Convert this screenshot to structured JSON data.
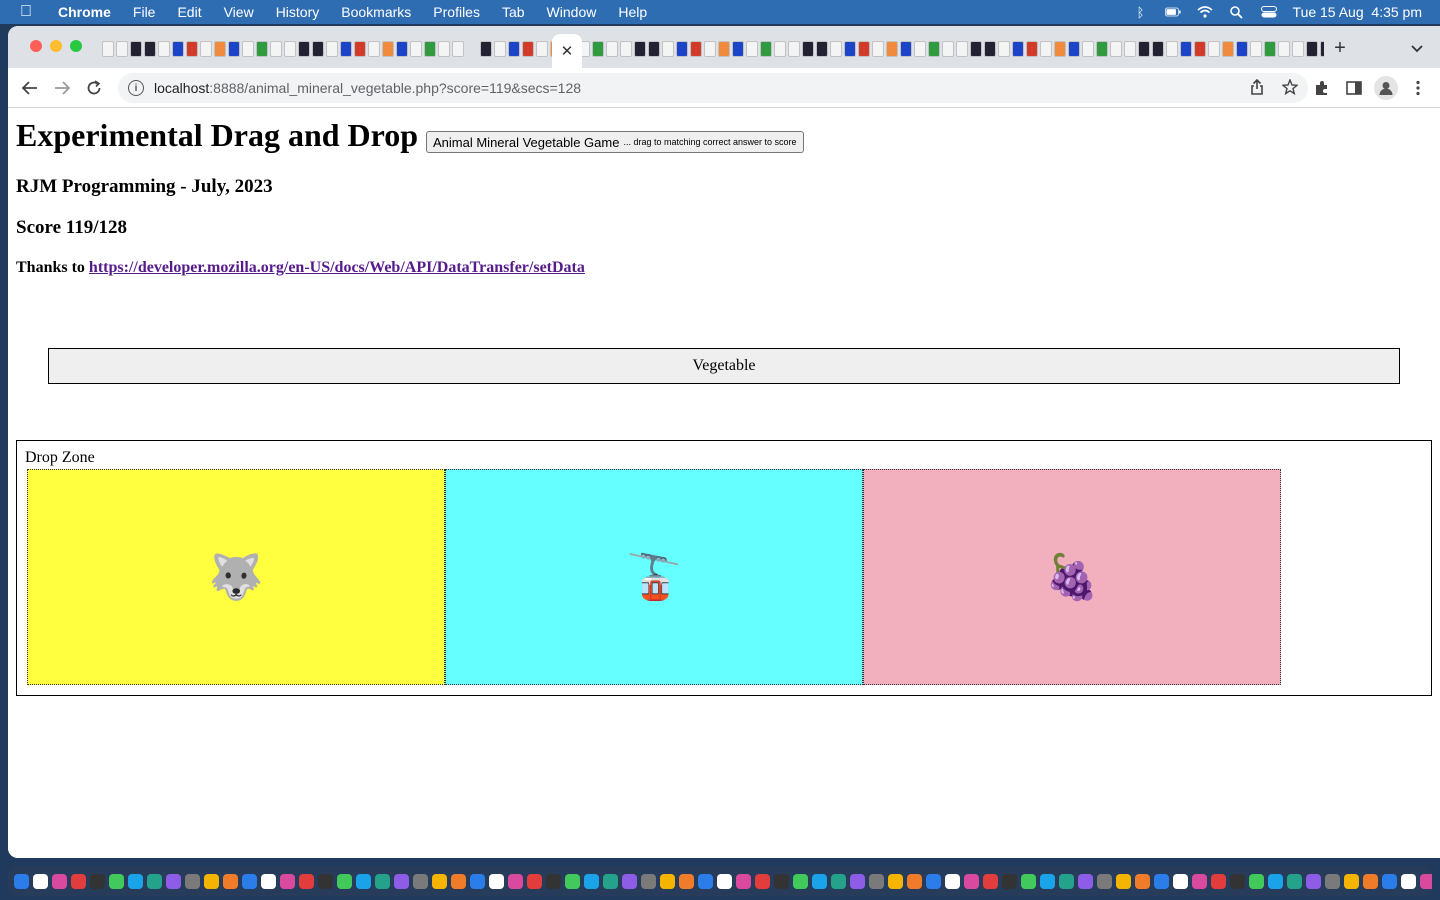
{
  "menubar": {
    "apple_icon": "apple-icon",
    "app_name": "Chrome",
    "items": [
      "File",
      "Edit",
      "View",
      "History",
      "Bookmarks",
      "Profiles",
      "Tab",
      "Window",
      "Help"
    ],
    "clock": "Tue 15 Aug  4:35 pm",
    "status_icons": [
      "bluetooth-icon",
      "battery-icon",
      "wifi-icon",
      "spotlight-icon",
      "control-center-icon"
    ]
  },
  "browser": {
    "active_tab_close": "✕",
    "new_tab": "+",
    "url_host": "localhost",
    "url_rest": ":8888/animal_mineral_vegetable.php?score=119&secs=128"
  },
  "page": {
    "title": "Experimental Drag and Drop",
    "game_button_main": "Animal Mineral Vegetable Game",
    "game_button_hint": "... drag to matching correct answer to score",
    "author": "RJM Programming - July, 2023",
    "score": "Score 119/128",
    "thanks_prefix": "Thanks to",
    "thanks_link": "https://developer.mozilla.org/en-US/docs/Web/API/DataTransfer/setData",
    "draggable_answer": "Vegetable",
    "drop_zone_label": "Drop Zone",
    "targets": [
      {
        "emoji": "🐺",
        "icon": "wolf-icon",
        "color": "#ffff40"
      },
      {
        "emoji": "🚡",
        "icon": "aerial-tramway-icon",
        "color": "#66ffff"
      },
      {
        "emoji": "🍇",
        "icon": "grapes-icon",
        "color": "#f2b0bf"
      }
    ]
  }
}
